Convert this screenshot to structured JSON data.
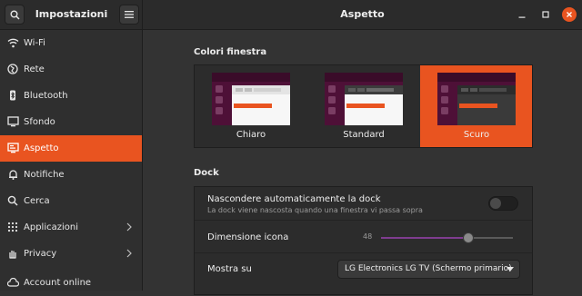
{
  "sidebar_header": {
    "title": "Impostazioni"
  },
  "window": {
    "title": "Aspetto"
  },
  "sidebar": {
    "items": [
      {
        "label": "Wi-Fi",
        "icon": "wifi-icon"
      },
      {
        "label": "Rete",
        "icon": "network-icon"
      },
      {
        "label": "Bluetooth",
        "icon": "bluetooth-icon"
      },
      {
        "label": "Sfondo",
        "icon": "background-icon"
      },
      {
        "label": "Aspetto",
        "icon": "appearance-icon",
        "active": true
      },
      {
        "label": "Notifiche",
        "icon": "bell-icon"
      },
      {
        "label": "Cerca",
        "icon": "search-icon"
      },
      {
        "label": "Applicazioni",
        "icon": "apps-icon",
        "has_submenu": true
      },
      {
        "label": "Privacy",
        "icon": "hand-icon",
        "has_submenu": true
      },
      {
        "label": "Account online",
        "icon": "cloud-icon"
      }
    ]
  },
  "window_colors": {
    "title": "Colori finestra",
    "options": [
      {
        "label": "Chiaro",
        "selected": false
      },
      {
        "label": "Standard",
        "selected": false
      },
      {
        "label": "Scuro",
        "selected": true
      }
    ]
  },
  "dock": {
    "title": "Dock",
    "autohide": {
      "label": "Nascondere automaticamente la dock",
      "description": "La dock viene nascosta quando una finestra vi passa sopra",
      "enabled": false
    },
    "icon_size": {
      "label": "Dimensione icona",
      "value": "48",
      "fraction": 0.66
    },
    "monitor": {
      "label": "Mostra su",
      "selected": "LG Electronics LG TV (Schermo primario)"
    }
  },
  "colors": {
    "accent": "#e95420",
    "slider_fill": "#7e3c8f"
  }
}
